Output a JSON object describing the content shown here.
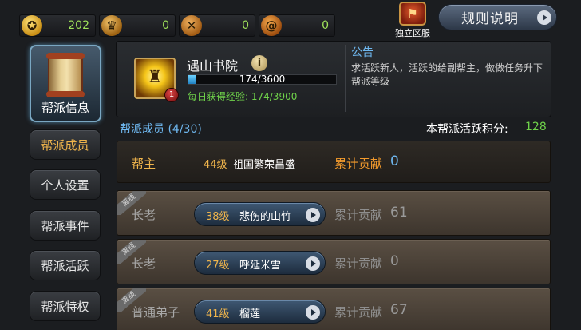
{
  "currencies": [
    {
      "icon": "gold-coin-icon",
      "value": "202"
    },
    {
      "icon": "helmet-icon",
      "value": "0"
    },
    {
      "icon": "crossed-swords-icon",
      "value": "0"
    },
    {
      "icon": "spiral-coin-icon",
      "value": "0"
    }
  ],
  "server": {
    "label": "独立区服",
    "icon": "banner-icon"
  },
  "rules_button": {
    "label": "规则说明"
  },
  "nav": {
    "active": {
      "label": "帮派信息",
      "icon": "scroll-icon"
    },
    "items": [
      {
        "label": "帮派成员",
        "selected": true
      },
      {
        "label": "个人设置",
        "selected": false
      },
      {
        "label": "帮派事件",
        "selected": false
      },
      {
        "label": "帮派活跃",
        "selected": false
      },
      {
        "label": "帮派特权",
        "selected": false
      }
    ]
  },
  "guild": {
    "name": "遇山书院",
    "badge": "1",
    "exp_text": "174/3600",
    "exp_current": 174,
    "exp_max": 3600,
    "daily_exp": "每日获得经验: 174/3900",
    "notice_title": "公告",
    "notice_text": "求活跃新人，活跃的给副帮主，做做任务升下帮派等级"
  },
  "members_header": {
    "title": "帮派成员 (4/30)",
    "score_label": "本帮派活跃积分:",
    "score_value": "128"
  },
  "leader": {
    "role": "帮主",
    "level": "44级",
    "name": "祖国繁荣昌盛",
    "contrib_label": "累计贡献",
    "contrib_value": "0"
  },
  "members": [
    {
      "tag": "离线",
      "role": "长老",
      "level": "38级",
      "name": "悲伤的山竹",
      "contrib_label": "累计贡献",
      "contrib_value": "61"
    },
    {
      "tag": "离线",
      "role": "长老",
      "level": "27级",
      "name": "呼延米雪",
      "contrib_label": "累计贡献",
      "contrib_value": "0"
    },
    {
      "tag": "离线",
      "role": "普通弟子",
      "level": "41级",
      "name": "榴莲",
      "contrib_label": "累计贡献",
      "contrib_value": "67"
    }
  ],
  "colors": {
    "accent_gold": "#f0b54c",
    "accent_blue": "#6fb8f0",
    "accent_green": "#6fd24a",
    "contrib_orange": "#f29a2c"
  }
}
